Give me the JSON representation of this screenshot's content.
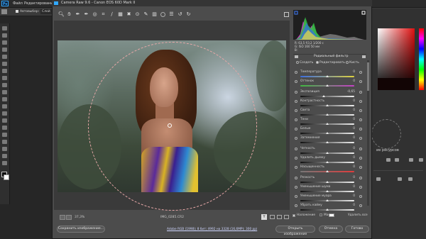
{
  "photoshop": {
    "logo": "Ps",
    "menu": [
      "Файл",
      "Редактирование"
    ],
    "options_label": "Автовыбор:",
    "options_value": "Слой",
    "panel_resources_label": "ие ресурсов"
  },
  "camera_raw": {
    "title": "Camera Raw 9.6 - Canon EOS 60D Mark II",
    "zoom": "37,3%",
    "file_name": "IMG_0285.CR2",
    "view_label": "Y",
    "histogram": {
      "readout_line1": "R:      63,5   f/3,2   1/200 с",
      "readout_line2": "G:       ISO 160   50 мм",
      "readout_line3": "B:"
    },
    "panel_title": "Радиальный фильтр",
    "modes": [
      {
        "label": "Создать",
        "selected": false
      },
      {
        "label": "Редактировать",
        "selected": true
      },
      {
        "label": "Кисть",
        "selected": false
      }
    ],
    "sliders": [
      {
        "label": "Температура",
        "value": "0",
        "position": 0.5,
        "track": "linear-gradient(to right,#3c6de0,#e0d23c)"
      },
      {
        "label": "Оттенок",
        "value": "0",
        "position": 0.5,
        "track": "linear-gradient(to right,#3fb83f,#c63fc6)"
      },
      {
        "label": "Экспозиция",
        "value": "-0,65",
        "position": 0.43,
        "track": "linear-gradient(to right,#111,#eee)"
      },
      {
        "label": "Контрастность",
        "value": "0",
        "position": 0.5,
        "track": "linear-gradient(to right,#111,#eee)"
      },
      {
        "label": "Света",
        "value": "0",
        "position": 0.5,
        "track": "linear-gradient(to right,#111,#eee)"
      },
      {
        "label": "Тени",
        "value": "0",
        "position": 0.5,
        "track": "linear-gradient(to right,#111,#eee)"
      },
      {
        "label": "Белые",
        "value": "0",
        "position": 0.5,
        "track": "linear-gradient(to right,#111,#eee)"
      },
      {
        "label": "Затемнения",
        "value": "0",
        "position": 0.5,
        "track": "linear-gradient(to right,#111,#eee)"
      },
      {
        "label": "Четкость",
        "value": "0",
        "position": 0.5,
        "track": "linear-gradient(to right,#111,#eee)"
      },
      {
        "label": "Удалить дымку",
        "value": "0",
        "position": 0.5,
        "track": "linear-gradient(to right,#111,#eee)"
      },
      {
        "label": "Насыщенность",
        "value": "0",
        "position": 0.5,
        "track": "linear-gradient(to right,#777,#e03c3c)"
      },
      {
        "label": "Резкость",
        "value": "0",
        "position": 0.5,
        "track": "linear-gradient(to right,#111,#eee)"
      },
      {
        "label": "Уменьшение шума",
        "value": "0",
        "position": 0.5,
        "track": "linear-gradient(to right,#111,#eee)"
      },
      {
        "label": "Уменьшение муара",
        "value": "0",
        "position": 0.5,
        "track": "linear-gradient(to right,#111,#eee)"
      },
      {
        "label": "Убрать кайму",
        "value": "0",
        "position": 0.5,
        "track": "linear-gradient(to right,#111,#eee)"
      }
    ],
    "overlay_label": "Наложение",
    "mask_label": "Маска",
    "delete_all_label": "Удалить все",
    "save_button": "Сохранить изображение...",
    "workflow_link": "Adobe RGB (1998); 8 бит; 4992 на 3328 (16,6MP); 300 ppi",
    "open_button": "Открыть изображение",
    "cancel_button": "Отмена",
    "done_button": "Готово"
  },
  "colors": {
    "accent": "#31a8ff",
    "dialog_bg": "#4c4c4c",
    "ellipse": "#e6a7a7"
  }
}
